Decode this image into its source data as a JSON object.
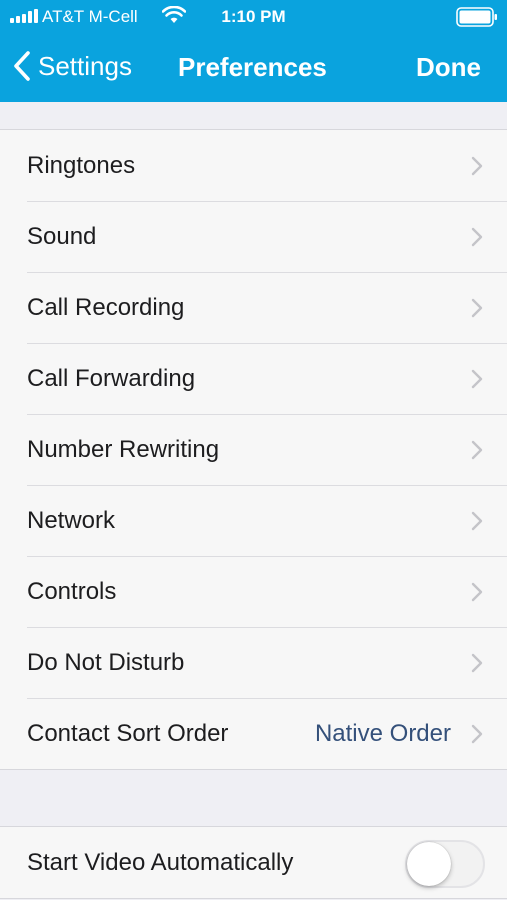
{
  "status": {
    "carrier": "AT&T M-Cell",
    "time": "1:10 PM"
  },
  "nav": {
    "back_label": "Settings",
    "title": "Preferences",
    "done_label": "Done"
  },
  "preferences": {
    "items": [
      {
        "label": "Ringtones",
        "value": ""
      },
      {
        "label": "Sound",
        "value": ""
      },
      {
        "label": "Call Recording",
        "value": ""
      },
      {
        "label": "Call Forwarding",
        "value": ""
      },
      {
        "label": "Number Rewriting",
        "value": ""
      },
      {
        "label": "Network",
        "value": ""
      },
      {
        "label": "Controls",
        "value": ""
      },
      {
        "label": "Do Not Disturb",
        "value": ""
      },
      {
        "label": "Contact Sort Order",
        "value": "Native Order"
      }
    ]
  },
  "video": {
    "label": "Start Video Automatically",
    "enabled": false
  },
  "colors": {
    "accent": "#0aa3de",
    "value_text": "#34507a",
    "background": "#efeff4"
  }
}
